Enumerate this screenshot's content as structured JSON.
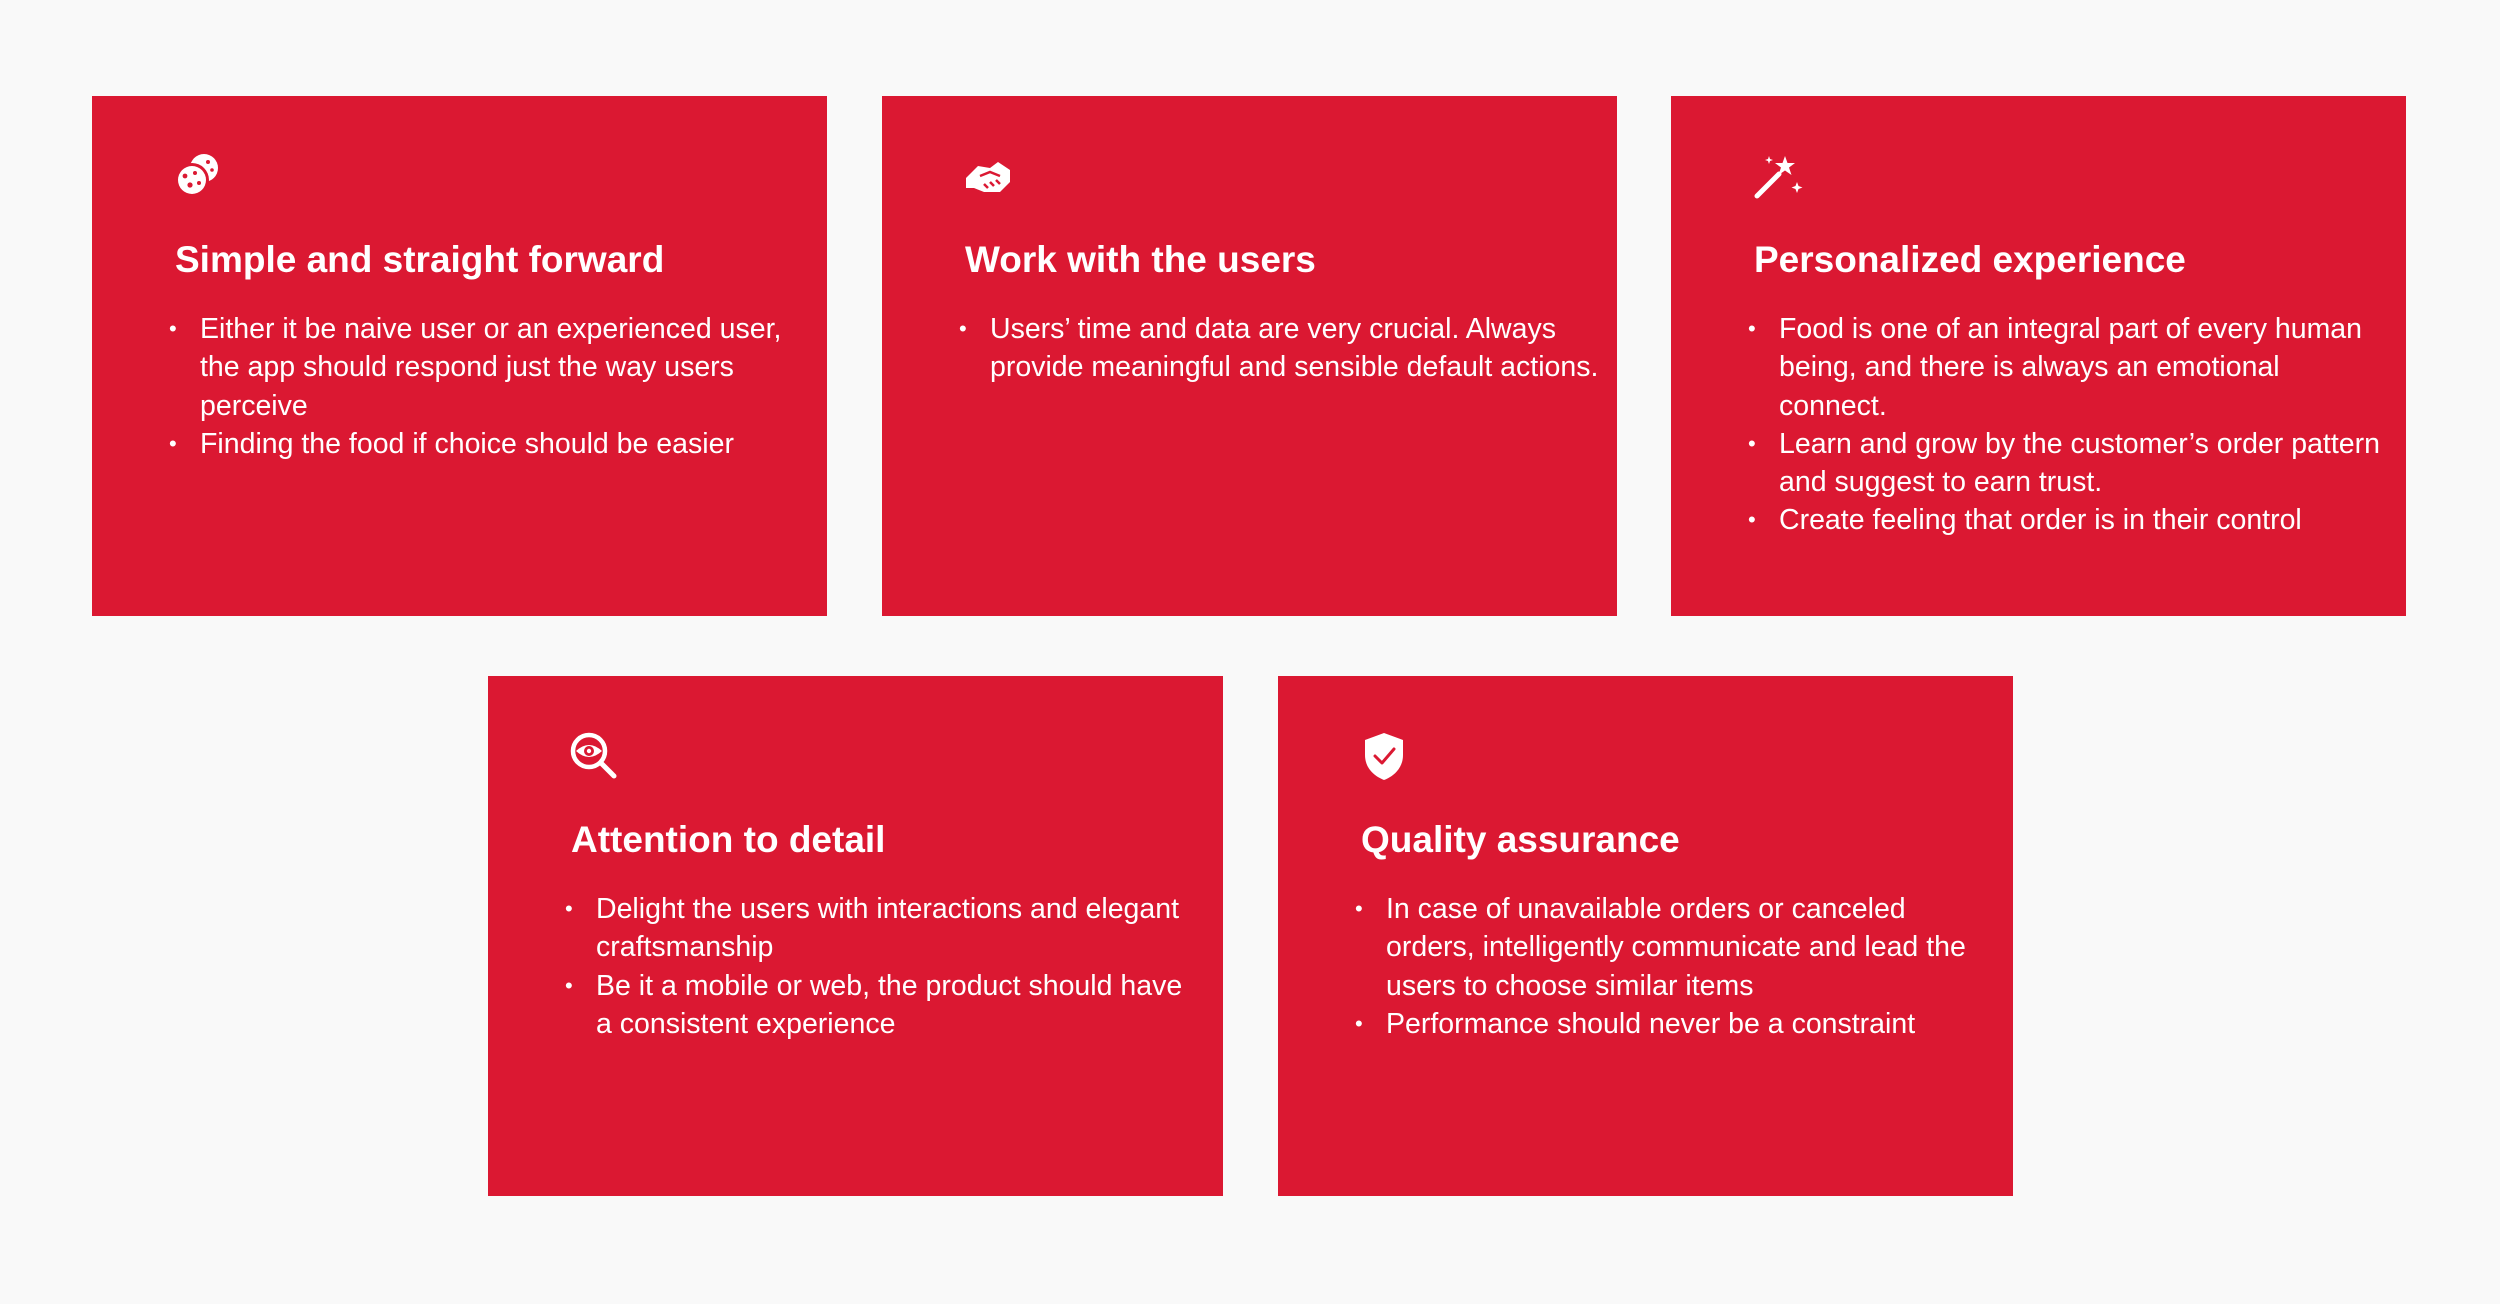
{
  "colors": {
    "background": "#f9f9f9",
    "card": "#db1832",
    "text": "#ffffff"
  },
  "cards": [
    {
      "icon": "cookie-icon",
      "title": "Simple and straight forward",
      "items": [
        "Either it be naive user or an experienced user, the app should respond just the way users perceive",
        "Finding the food if choice should be easier"
      ]
    },
    {
      "icon": "handshake-icon",
      "title": "Work with the users",
      "items": [
        "Users’ time and data are very crucial. Always provide meaningful and sensible default actions."
      ]
    },
    {
      "icon": "magic-wand-icon",
      "title": "Personalized experience",
      "items": [
        "Food is one of an integral part of every human being, and there is always an emotional connect.",
        "Learn and grow by the customer’s order pattern and suggest to earn trust.",
        "Create feeling that order is in their control"
      ]
    },
    {
      "icon": "eye-magnifier-icon",
      "title": "Attention to detail",
      "items": [
        "Delight the users with interactions and elegant craftsmanship",
        "Be it a mobile or web, the product should have a consistent experience"
      ]
    },
    {
      "icon": "shield-check-icon",
      "title": "Quality assurance",
      "items": [
        "In case of unavailable orders or canceled orders, intelligently communicate and lead the users to choose similar items",
        "Performance should never be a constraint"
      ]
    }
  ]
}
